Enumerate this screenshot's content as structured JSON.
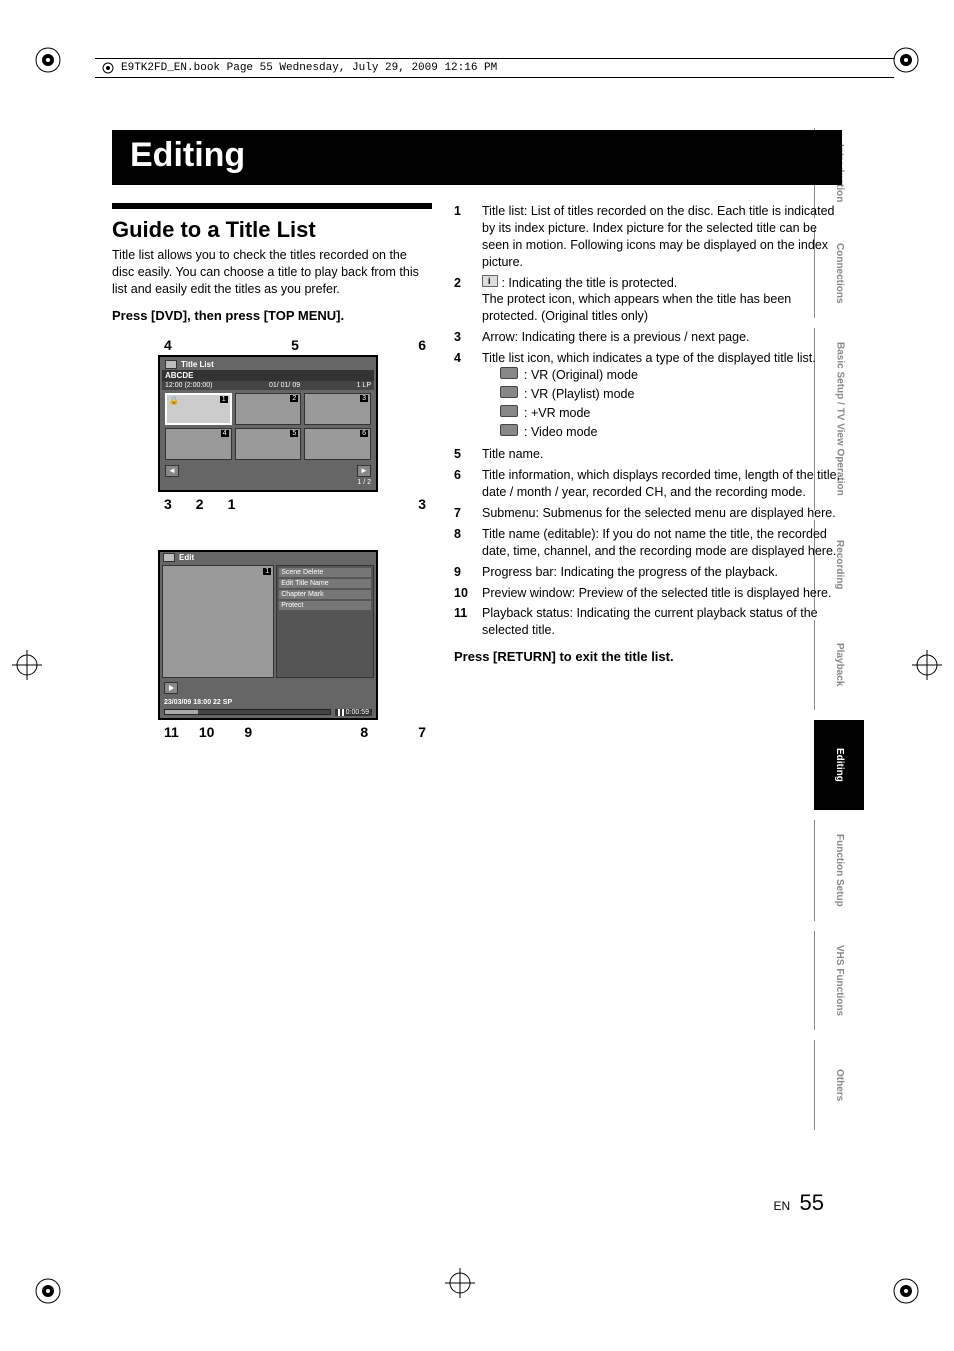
{
  "print_header": "E9TK2FD_EN.book  Page 55  Wednesday, July 29, 2009  12:16 PM",
  "chapter_title": "Editing",
  "section_title": "Guide to a Title List",
  "intro_text": "Title list allows you to check the titles recorded on the disc easily. You can choose a title to play back from this list and easily edit the titles as you prefer.",
  "instruction_1": "Press [DVD], then press [TOP MENU].",
  "instruction_2": "Press [RETURN] to exit the title list.",
  "side_tabs": [
    "Introduction",
    "Connections",
    "Basic Setup /\nTV View Operation",
    "Recording",
    "Playback",
    "Editing",
    "Function Setup",
    "VHS Functions",
    "Others"
  ],
  "active_tab_index": 5,
  "screen1": {
    "header": "Title List",
    "title_name": "ABCDE",
    "info_time": "12:00 (2:00:00)",
    "info_date": "01/ 01/ 09",
    "info_mode": "1 LP",
    "page_indicator": "1 / 2",
    "callouts_top": [
      "4",
      "5",
      "6"
    ],
    "callouts_bottom_left": [
      "3",
      "2",
      "1"
    ],
    "callouts_bottom_right": "3"
  },
  "screen2": {
    "header": "Edit",
    "submenu": [
      "Scene Delete",
      "Edit Title Name",
      "Chapter Mark",
      "Protect"
    ],
    "info_line": "23/03/09 18:00  22  SP",
    "timecode": "0:00:59",
    "callouts_bottom": [
      "11",
      "10",
      "9",
      "8",
      "7"
    ]
  },
  "descriptions": [
    {
      "n": "1",
      "t": "Title list: List of titles recorded on the disc. Each title is indicated by its index picture. Index picture for the selected title can be seen in motion. Following icons may be displayed on the index picture."
    },
    {
      "n": "2",
      "t": ": Indicating the title is protected.",
      "icon": true,
      "extra": "The protect icon, which appears when the title has been protected. (Original titles only)"
    },
    {
      "n": "3",
      "t": "Arrow: Indicating there is a previous / next page."
    },
    {
      "n": "4",
      "t": "Title list icon, which indicates a type of the displayed title list.",
      "subs": [
        ": VR (Original) mode",
        ": VR (Playlist) mode",
        ": +VR mode",
        ": Video mode"
      ]
    },
    {
      "n": "5",
      "t": "Title name."
    },
    {
      "n": "6",
      "t": "Title information, which displays recorded time, length of the title, date / month / year, recorded CH, and the recording mode."
    },
    {
      "n": "7",
      "t": "Submenu: Submenus for the selected menu are displayed here."
    },
    {
      "n": "8",
      "t": "Title name (editable): If you do not name the title, the recorded date, time, channel, and the recording mode are displayed here."
    },
    {
      "n": "9",
      "t": "Progress bar: Indicating the progress of the playback."
    },
    {
      "n": "10",
      "t": "Preview window: Preview of the selected title is displayed here."
    },
    {
      "n": "11",
      "t": "Playback status: Indicating the current playback status of the selected title."
    }
  ],
  "page_lang": "EN",
  "page_number": "55"
}
